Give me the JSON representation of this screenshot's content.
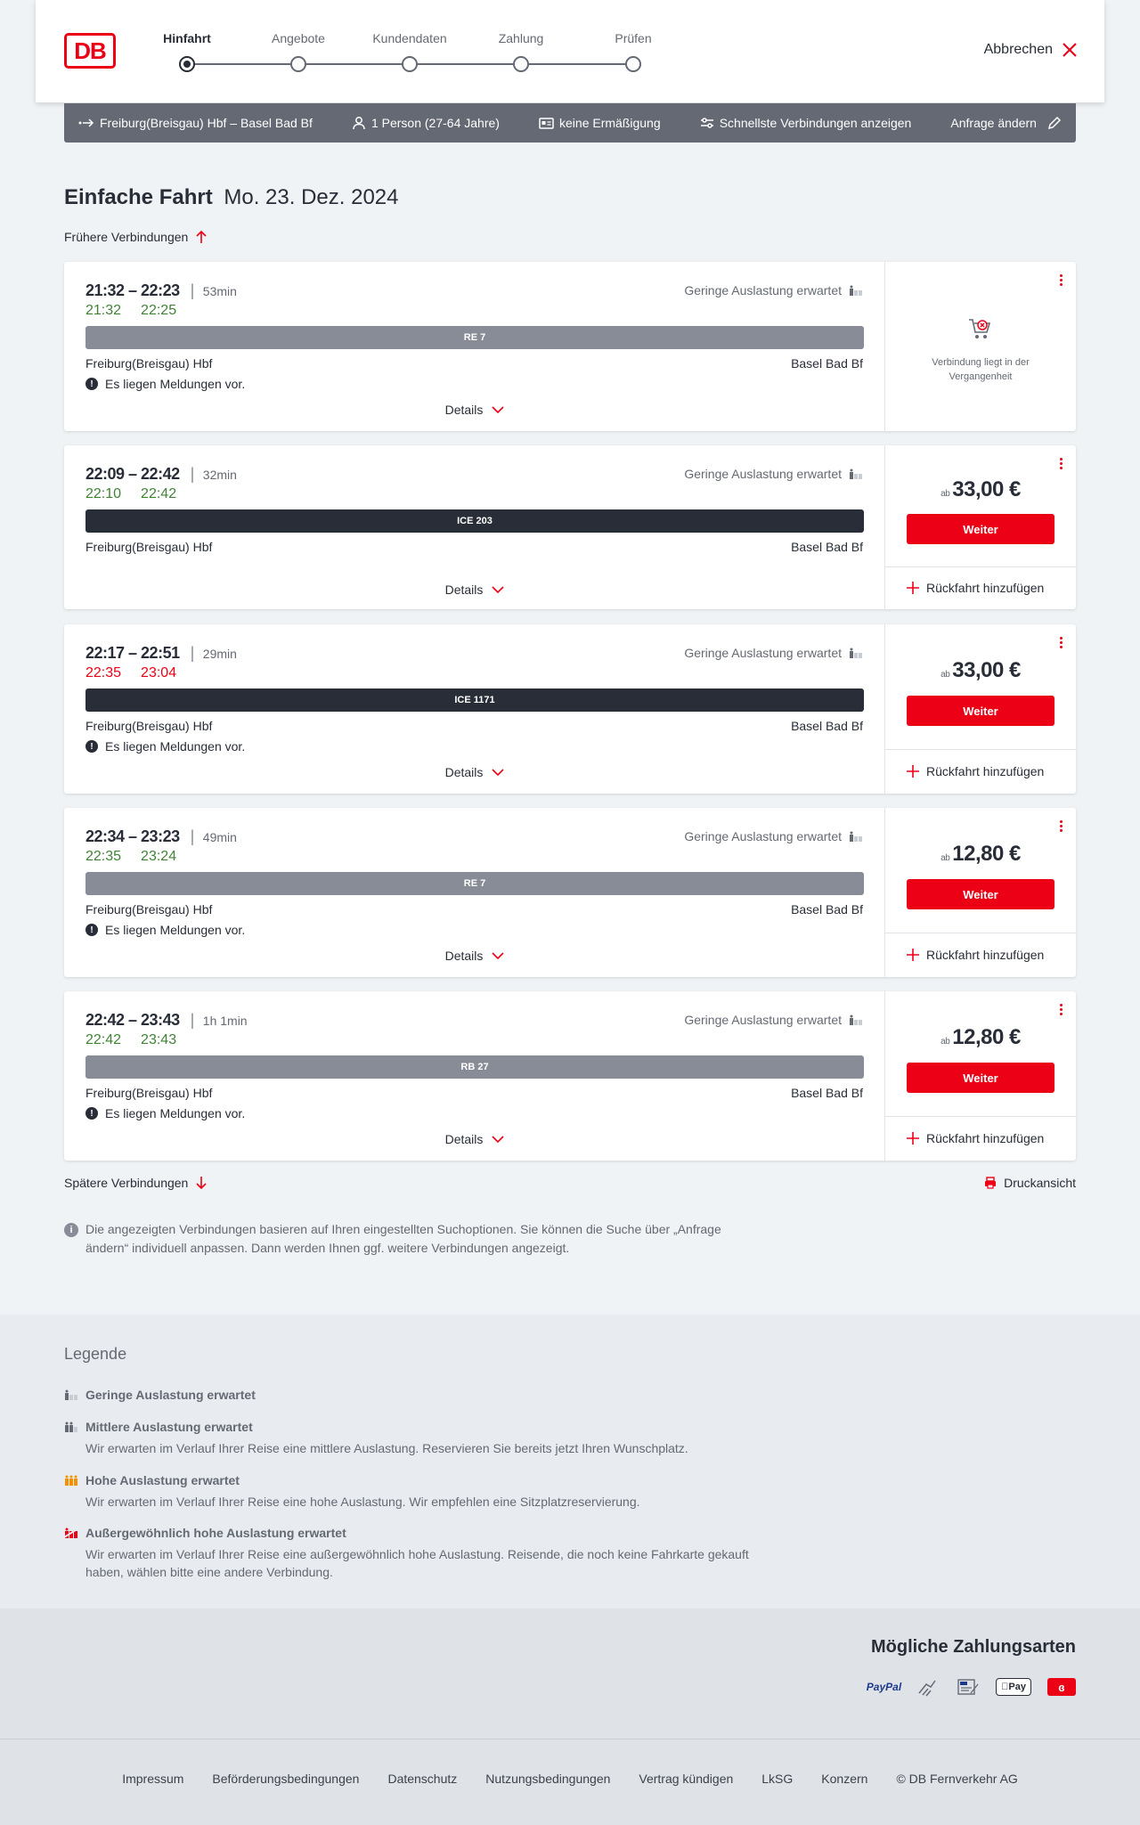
{
  "header": {
    "logo": "DB",
    "steps": [
      "Hinfahrt",
      "Angebote",
      "Kundendaten",
      "Zahlung",
      "Prüfen"
    ],
    "cancel": "Abbrechen"
  },
  "search": {
    "route": "Freiburg(Breisgau) Hbf – Basel Bad Bf",
    "persons": "1 Person (27-64 Jahre)",
    "discount": "keine Ermäßigung",
    "fastest": "Schnellste Verbindungen anzeigen",
    "change": "Anfrage ändern"
  },
  "page": {
    "title": "Einfache Fahrt",
    "date": "Mo. 23. Dez. 2024",
    "earlier": "Frühere Verbindungen",
    "later": "Spätere Verbindungen",
    "print": "Druckansicht",
    "info": "Die angezeigten Verbindungen basieren auf Ihren eingestellten Suchoptionen. Sie können die Suche über „Anfrage ändern“ individuell anpassen. Dann werden Ihnen ggf. weitere Verbindungen angezeigt."
  },
  "connections": [
    {
      "times": "21:32 – 22:23",
      "duration": "53min",
      "rt_dep": "21:32",
      "rt_arr": "22:25",
      "load": "Geringe Auslastung erwartet",
      "train": "RE 7",
      "from": "Freiburg(Breisgau) Hbf",
      "to": "Basel Bad Bf",
      "message": "Es liegen Meldungen vor.",
      "details": "Details",
      "past": "Verbindung liegt in der Vergangenheit"
    },
    {
      "times": "22:09 – 22:42",
      "duration": "32min",
      "rt_dep": "22:10",
      "rt_arr": "22:42",
      "load": "Geringe Auslastung erwartet",
      "train": "ICE 203",
      "from": "Freiburg(Breisgau) Hbf",
      "to": "Basel Bad Bf",
      "details": "Details",
      "price_prefix": "ab",
      "price": "33,00 €",
      "weiter": "Weiter",
      "return": "Rückfahrt hinzufügen"
    },
    {
      "times": "22:17 – 22:51",
      "duration": "29min",
      "rt_dep": "22:35",
      "rt_arr": "23:04",
      "load": "Geringe Auslastung erwartet",
      "train": "ICE 1171",
      "from": "Freiburg(Breisgau) Hbf",
      "to": "Basel Bad Bf",
      "message": "Es liegen Meldungen vor.",
      "details": "Details",
      "price_prefix": "ab",
      "price": "33,00 €",
      "weiter": "Weiter",
      "return": "Rückfahrt hinzufügen"
    },
    {
      "times": "22:34 – 23:23",
      "duration": "49min",
      "rt_dep": "22:35",
      "rt_arr": "23:24",
      "load": "Geringe Auslastung erwartet",
      "train": "RE 7",
      "from": "Freiburg(Breisgau) Hbf",
      "to": "Basel Bad Bf",
      "message": "Es liegen Meldungen vor.",
      "details": "Details",
      "price_prefix": "ab",
      "price": "12,80 €",
      "weiter": "Weiter",
      "return": "Rückfahrt hinzufügen"
    },
    {
      "times": "22:42 – 23:43",
      "duration": "1h 1min",
      "rt_dep": "22:42",
      "rt_arr": "23:43",
      "load": "Geringe Auslastung erwartet",
      "train": "RB 27",
      "from": "Freiburg(Breisgau) Hbf",
      "to": "Basel Bad Bf",
      "message": "Es liegen Meldungen vor.",
      "details": "Details",
      "price_prefix": "ab",
      "price": "12,80 €",
      "weiter": "Weiter",
      "return": "Rückfahrt hinzufügen"
    }
  ],
  "legend": {
    "title": "Legende",
    "items": [
      {
        "title": "Geringe Auslastung erwartet",
        "desc": ""
      },
      {
        "title": "Mittlere Auslastung erwartet",
        "desc": "Wir erwarten im Verlauf Ihrer Reise eine mittlere Auslastung. Reservieren Sie bereits jetzt Ihren Wunschplatz."
      },
      {
        "title": "Hohe Auslastung erwartet",
        "desc": "Wir erwarten im Verlauf Ihrer Reise eine hohe Auslastung. Wir empfehlen eine Sitzplatzreservierung."
      },
      {
        "title": "Außergewöhnlich hohe Auslastung erwartet",
        "desc": "Wir erwarten im Verlauf Ihrer Reise eine außergewöhnlich hohe Auslastung. Reisende, die noch keine Fahrkarte gekauft haben, wählen bitte eine andere Verbindung."
      }
    ]
  },
  "payment": {
    "title": "Mögliche Zahlungsarten",
    "paypal": "PayPal",
    "applepay": "Pay"
  },
  "footer": {
    "links": [
      "Impressum",
      "Beförderungsbedingungen",
      "Datenschutz",
      "Nutzungsbedingungen",
      "Vertrag kündigen",
      "LkSG",
      "Konzern",
      "© DB Fernverkehr AG"
    ]
  },
  "colors": {
    "brand": "#ec0016",
    "ontime": "#408335",
    "delay": "#ec0016",
    "regional": "#878c96",
    "longdistance": "#282d37",
    "high_load": "#f39200"
  }
}
